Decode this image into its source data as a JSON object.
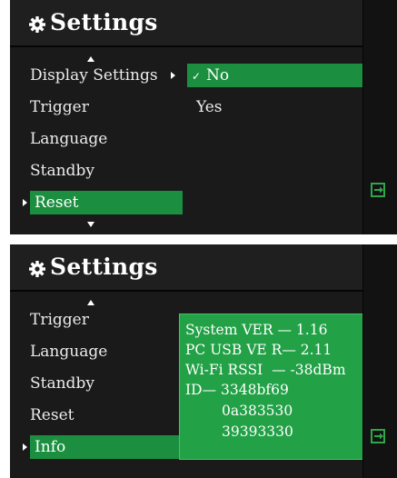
{
  "screen1": {
    "title": "Settings",
    "menu": [
      "Display Settings",
      "Trigger",
      "Language",
      "Standby",
      "Reset"
    ],
    "selected_menu": "Reset",
    "options": [
      {
        "label": "No",
        "selected": true
      },
      {
        "label": "Yes",
        "selected": false
      }
    ]
  },
  "screen2": {
    "title": "Settings",
    "menu": [
      "Trigger",
      "Language",
      "Standby",
      "Reset",
      "Info"
    ],
    "selected_menu": "Info",
    "info": {
      "system_ver_label": "System VER",
      "system_ver_sep": "—",
      "system_ver_value": "1.16",
      "pc_usb_ver_label": "PC USB VE R",
      "pc_usb_ver_sep": "—",
      "pc_usb_ver_value": "2.11",
      "wifi_rssi_label": "Wi-Fi RSSI",
      "wifi_rssi_sep": "—",
      "wifi_rssi_value": "-38dBm",
      "id_label": "ID",
      "id_sep": "—",
      "id_lines": [
        "3348bf69",
        "0a383530",
        "39393330"
      ]
    }
  },
  "icons": {
    "gear": "gear-icon",
    "exit": "exit-icon",
    "scroll_up": "chevron-up-icon",
    "scroll_down": "chevron-down-icon",
    "pointer": "pointer-right-icon",
    "check": "check-icon"
  },
  "colors": {
    "highlight": "#1b8f3f",
    "info_box": "#22a146",
    "panel": "#1a1a1a",
    "exit_icon": "#2ea64a"
  }
}
